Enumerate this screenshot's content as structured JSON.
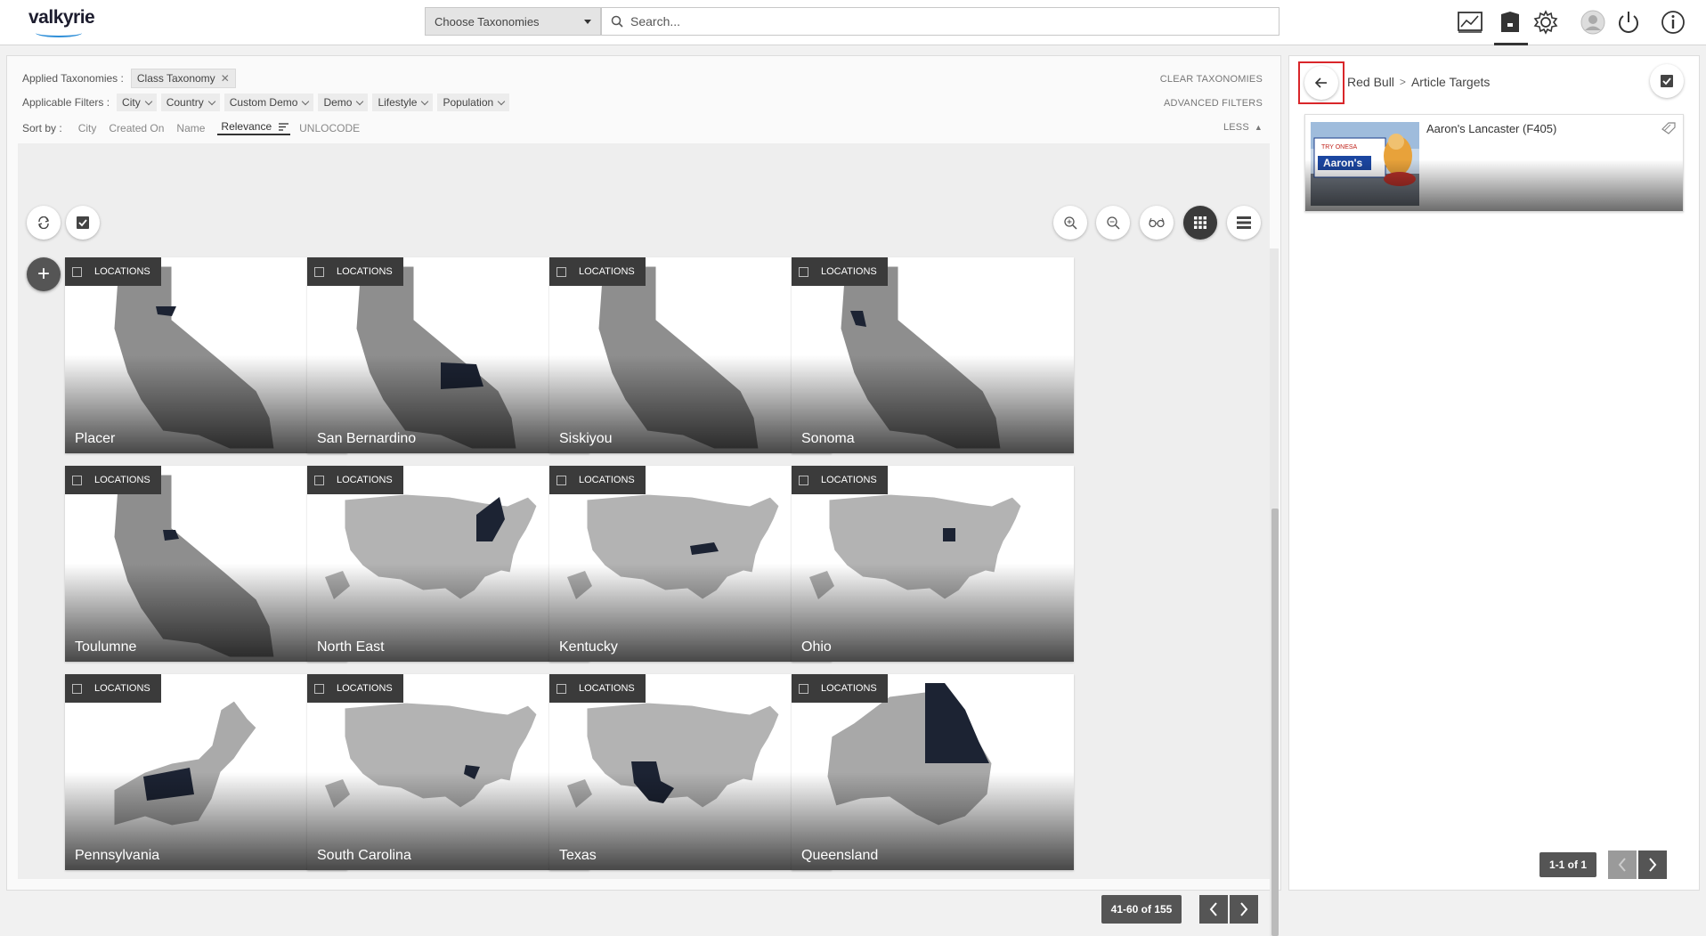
{
  "topbar": {
    "logo": "valkyrie",
    "taxonomy_select": "Choose Taxonomies",
    "search_placeholder": "Search...",
    "icons": [
      "analytics-icon",
      "archive-icon",
      "settings-icon",
      "user-avatar-icon",
      "power-icon",
      "info-icon"
    ]
  },
  "filters": {
    "applied_label": "Applied Taxonomies :",
    "applied_chip": "Class Taxonomy",
    "applicable_label": "Applicable Filters :",
    "filter_options": [
      "City",
      "Country",
      "Custom Demo",
      "Demo",
      "Lifestyle",
      "Population"
    ],
    "sort_label": "Sort by :",
    "sort_options": [
      "City",
      "Created On",
      "Name",
      "Relevance",
      "UNLOCODE"
    ],
    "clear": "CLEAR TAXONOMIES",
    "advanced": "ADVANCED FILTERS",
    "less": "LESS"
  },
  "cards": [
    {
      "badge": "LOCATIONS",
      "title": "Placer",
      "map": "california"
    },
    {
      "badge": "LOCATIONS",
      "title": "San Bernardino",
      "map": "california"
    },
    {
      "badge": "LOCATIONS",
      "title": "Siskiyou",
      "map": "california"
    },
    {
      "badge": "LOCATIONS",
      "title": "Sonoma",
      "map": "california"
    },
    {
      "badge": "LOCATIONS",
      "title": "Toulumne",
      "map": "california"
    },
    {
      "badge": "LOCATIONS",
      "title": "North East",
      "map": "usa"
    },
    {
      "badge": "LOCATIONS",
      "title": "Kentucky",
      "map": "usa"
    },
    {
      "badge": "LOCATIONS",
      "title": "Ohio",
      "map": "usa"
    },
    {
      "badge": "LOCATIONS",
      "title": "Pennsylvania",
      "map": "northeast"
    },
    {
      "badge": "LOCATIONS",
      "title": "South Carolina",
      "map": "usa"
    },
    {
      "badge": "LOCATIONS",
      "title": "Texas",
      "map": "usa"
    },
    {
      "badge": "LOCATIONS",
      "title": "Queensland",
      "map": "australia"
    }
  ],
  "pagination": {
    "range": "41-60 of 155"
  },
  "right_panel": {
    "breadcrumb": [
      "Red Bull",
      "Article Targets"
    ],
    "article": {
      "title": "Aaron's Lancaster (F405)"
    },
    "pagination": {
      "range": "1-1 of 1"
    }
  },
  "colors": {
    "highlight": "#1c2333",
    "map_fill": "#b3b3b3",
    "badge_bg": "#3b3b3b",
    "back_border": "#d9262a"
  }
}
